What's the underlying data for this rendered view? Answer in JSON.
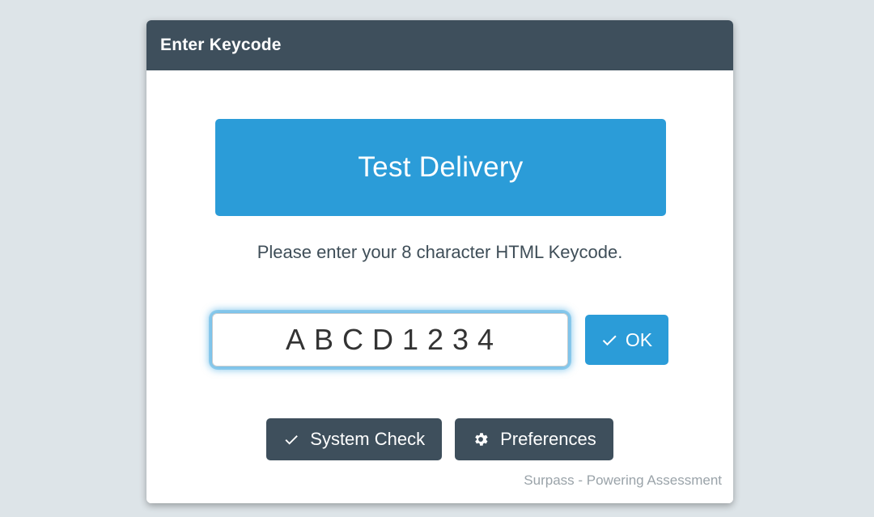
{
  "window": {
    "background_color": "#dde4e8"
  },
  "dialog": {
    "header": {
      "title": "Enter Keycode",
      "background_color": "#3e4f5c",
      "title_color": "#ffffff"
    },
    "banner": {
      "label": "Test Delivery",
      "background_color": "#2b9cd8",
      "text_color": "#ffffff"
    },
    "instruction": {
      "text": "Please enter your 8 character HTML Keycode.",
      "color": "#3f4e58"
    },
    "keycode": {
      "value": "ABCD1234",
      "placeholder": "",
      "focused": true,
      "focus_ring_color": "#46aae1",
      "ok_button": {
        "label": "OK",
        "icon": "check-icon",
        "background_color": "#2b9cd8"
      }
    },
    "actions": [
      {
        "label": "System Check",
        "icon": "check-icon",
        "background_color": "#3e4f5c"
      },
      {
        "label": "Preferences",
        "icon": "gear-icon",
        "background_color": "#3e4f5c"
      }
    ],
    "footer": {
      "text": "Surpass - Powering Assessment",
      "color": "#9aa3a9"
    }
  }
}
